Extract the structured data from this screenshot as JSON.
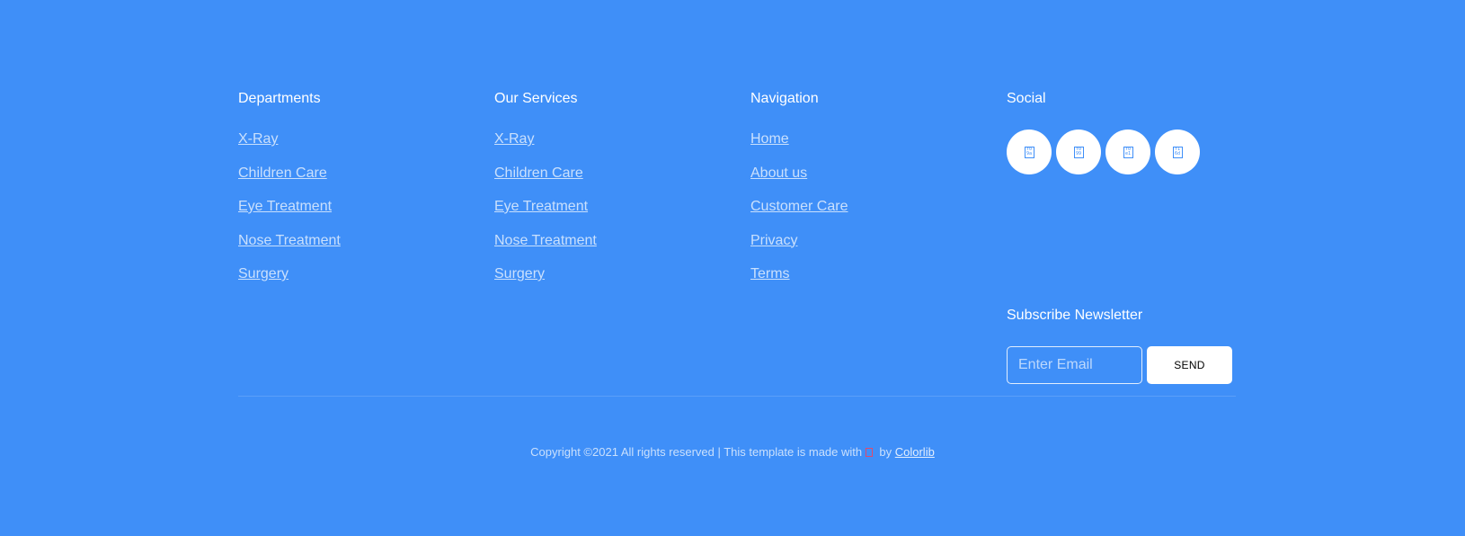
{
  "columns": {
    "departments": {
      "title": "Departments",
      "links": [
        "X-Ray",
        "Children Care",
        "Eye Treatment",
        "Nose Treatment",
        "Surgery"
      ]
    },
    "services": {
      "title": "Our Services",
      "links": [
        "X-Ray",
        "Children Care",
        "Eye Treatment",
        "Nose Treatment",
        "Surgery"
      ]
    },
    "navigation": {
      "title": "Navigation",
      "links": [
        "Home",
        "About us",
        "Customer Care",
        "Privacy",
        "Terms"
      ]
    }
  },
  "social": {
    "title": "Social",
    "icons": [
      "facebook-icon",
      "twitter-icon",
      "linkedin-icon",
      "instagram-icon"
    ]
  },
  "newsletter": {
    "title": "Subscribe Newsletter",
    "email_placeholder": "Enter Email",
    "email_value": "",
    "send_label": "SEND"
  },
  "footer": {
    "copyright_text": "Copyright ©2021 All rights reserved | This template is made with",
    "by_text": "by",
    "credit_link": "Colorlib",
    "heart_icon": "heart-icon"
  },
  "colors": {
    "background": "#3f8ff8",
    "text": "#ffffff",
    "button_bg": "#ffffff",
    "heart": "#e04a6b"
  }
}
